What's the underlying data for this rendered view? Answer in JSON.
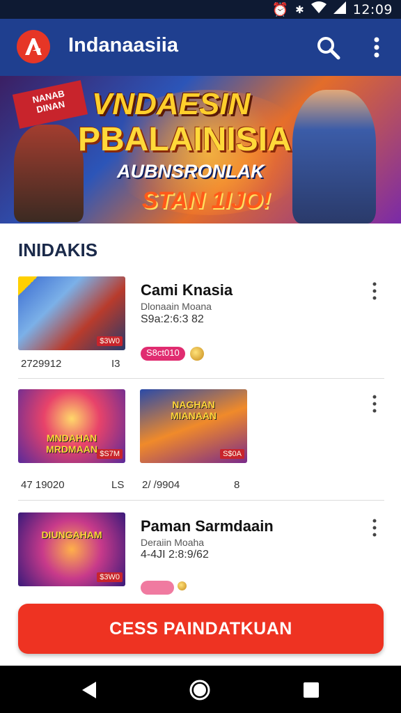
{
  "status_bar": {
    "time": "12:09",
    "icons": [
      "alarm-icon",
      "bluetooth-icon",
      "wifi-icon",
      "signal-icon"
    ]
  },
  "app_bar": {
    "title": "Indanaasiia",
    "logo_icon": "app-logo-icon",
    "actions": [
      "search-icon",
      "more-vert-icon"
    ]
  },
  "hero": {
    "flag_text": "NANAB\nDINAN",
    "line1": "VNDAESIN",
    "line2": "PBALAINISIA",
    "line3": "AUBNSRONLAK",
    "line4": "STAN 1IJO!"
  },
  "section": {
    "title": "INIDAKIS"
  },
  "items": [
    {
      "thumbs": [
        {
          "caption": "",
          "tag": "$3W0"
        }
      ],
      "date": "2729912",
      "count": "I3",
      "title": "Cami Knasia",
      "subtitle": "Dlonaain Moana",
      "stat": "S9a:2:6:3 82",
      "badge": "S8ct010"
    },
    {
      "thumbs": [
        {
          "caption": "MNDAHAN\nMRDMAAN",
          "tag": "$S7M"
        },
        {
          "caption": "NAGHAN\nMIANAAN",
          "tag": "S$0A"
        }
      ],
      "date": "47 19020",
      "count": "LS",
      "date2": "2/ /9904",
      "count2": "8"
    },
    {
      "thumbs": [
        {
          "caption": "DIUNGAHAM",
          "tag": "$3W0"
        }
      ],
      "title": "Paman Sarmdaain",
      "subtitle": "Deraiin Moaha",
      "stat": "4-4JI 2:8:9/62",
      "badge": ""
    }
  ],
  "cta": {
    "label": "CESS PAINDATKUAN"
  },
  "nav": [
    "back-icon",
    "home-icon",
    "recents-icon"
  ],
  "colors": {
    "app_bar": "#1f3f8f",
    "status_bar": "#0e1a33",
    "accent": "#ee3322",
    "badge": "#e02c70"
  }
}
